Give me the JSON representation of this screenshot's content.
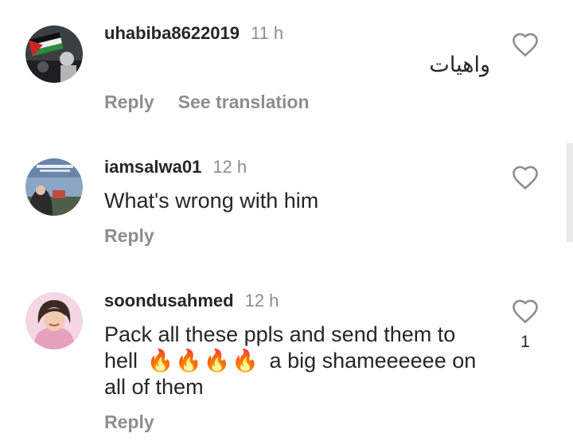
{
  "comments": [
    {
      "username": "uhabiba8622019",
      "time": "11 h",
      "text": "واهيات",
      "reply_label": "Reply",
      "translate_label": "See translation"
    },
    {
      "username": "iamsalwa01",
      "time": "12 h",
      "text": "What's wrong with him",
      "reply_label": "Reply"
    },
    {
      "username": "soondusahmed",
      "time": "12 h",
      "text_before": "Pack all these ppls and send them to hell",
      "emoji": "🔥🔥🔥🔥",
      "text_after": "a big shameeeeee on all of them",
      "reply_label": "Reply",
      "like_count": "1"
    }
  ],
  "icons": {
    "like": "heart-outline-icon"
  },
  "colors": {
    "text_primary": "#262626",
    "text_secondary": "#8e8e8e",
    "flame": "#f5a623"
  }
}
